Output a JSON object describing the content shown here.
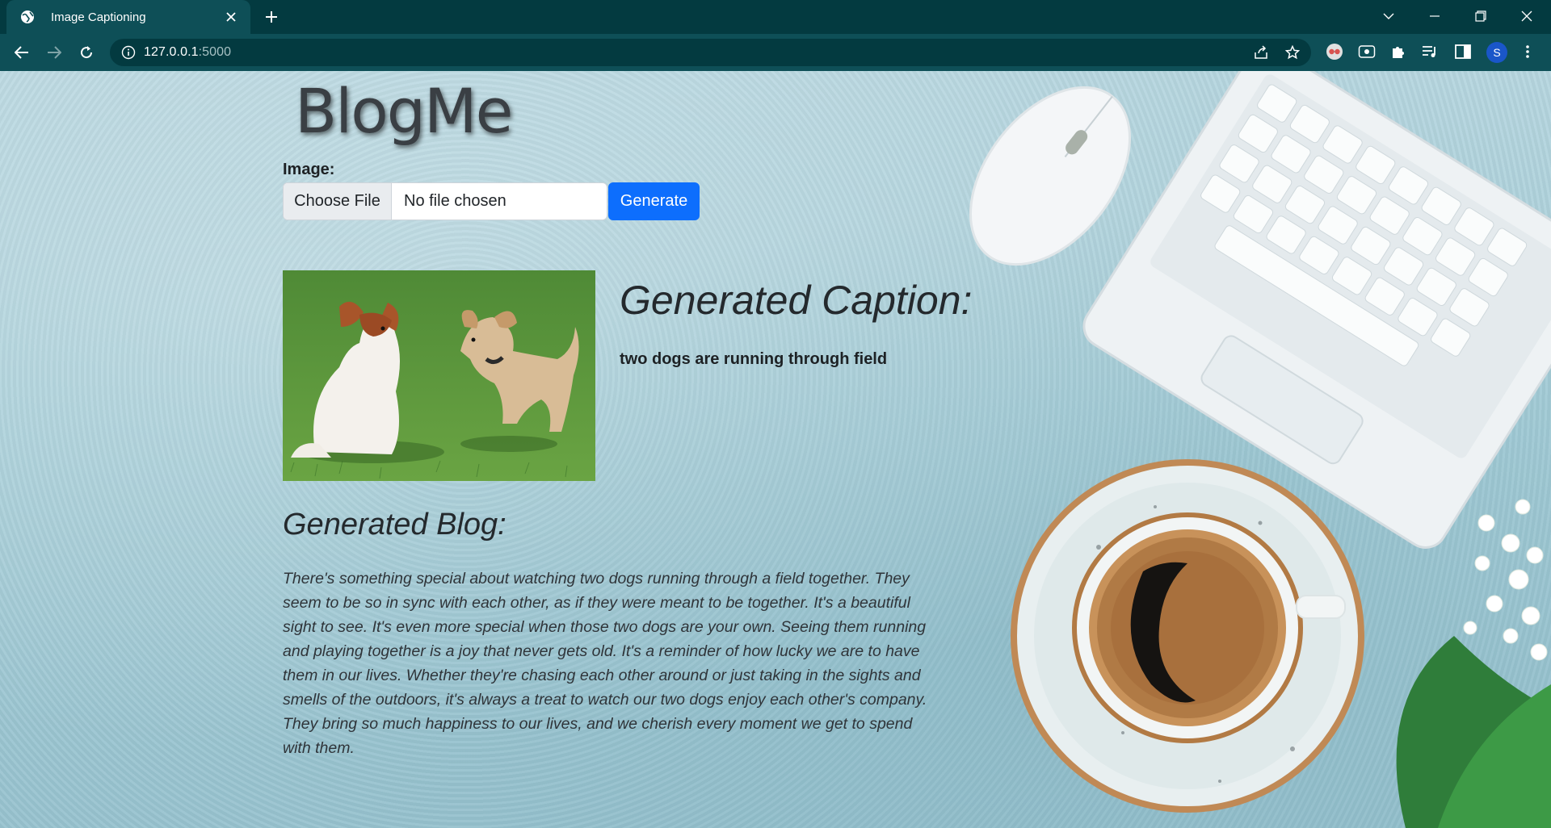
{
  "browser": {
    "tab_title": "Image Captioning",
    "url_host": "127.0.0.1",
    "url_port": ":5000",
    "profile_initial": "S"
  },
  "page": {
    "site_title": "BlogMe",
    "image_label": "Image:",
    "file_button_label": "Choose File",
    "file_status": "No file chosen",
    "generate_label": "Generate",
    "caption_heading": "Generated Caption:",
    "caption_text": "two dogs are running through field",
    "blog_heading": "Generated Blog:",
    "blog_text": "There's something special about watching two dogs running through a field together. They seem to be so in sync with each other, as if they were meant to be together. It's a beautiful sight to see. It's even more special when those two dogs are your own. Seeing them running and playing together is a joy that never gets old. It's a reminder of how lucky we are to have them in our lives. Whether they're chasing each other around or just taking in the sights and smells of the outdoors, it's always a treat to watch our two dogs enjoy each other's company. They bring so much happiness to our lives, and we cherish every moment we get to spend with them."
  },
  "colors": {
    "chrome_dark": "#033a40",
    "chrome_tab": "#0e4f57",
    "primary_button": "#0d6efd",
    "page_background": "#a4ccd7"
  },
  "icons": [
    "globe-icon",
    "close-icon",
    "plus-icon",
    "chevron-down-icon",
    "minimize-icon",
    "restore-icon",
    "back-arrow-icon",
    "forward-arrow-icon",
    "reload-icon",
    "info-icon",
    "share-icon",
    "star-icon",
    "puzzle-icon",
    "media-icon",
    "side-panel-icon",
    "kebab-menu-icon"
  ]
}
